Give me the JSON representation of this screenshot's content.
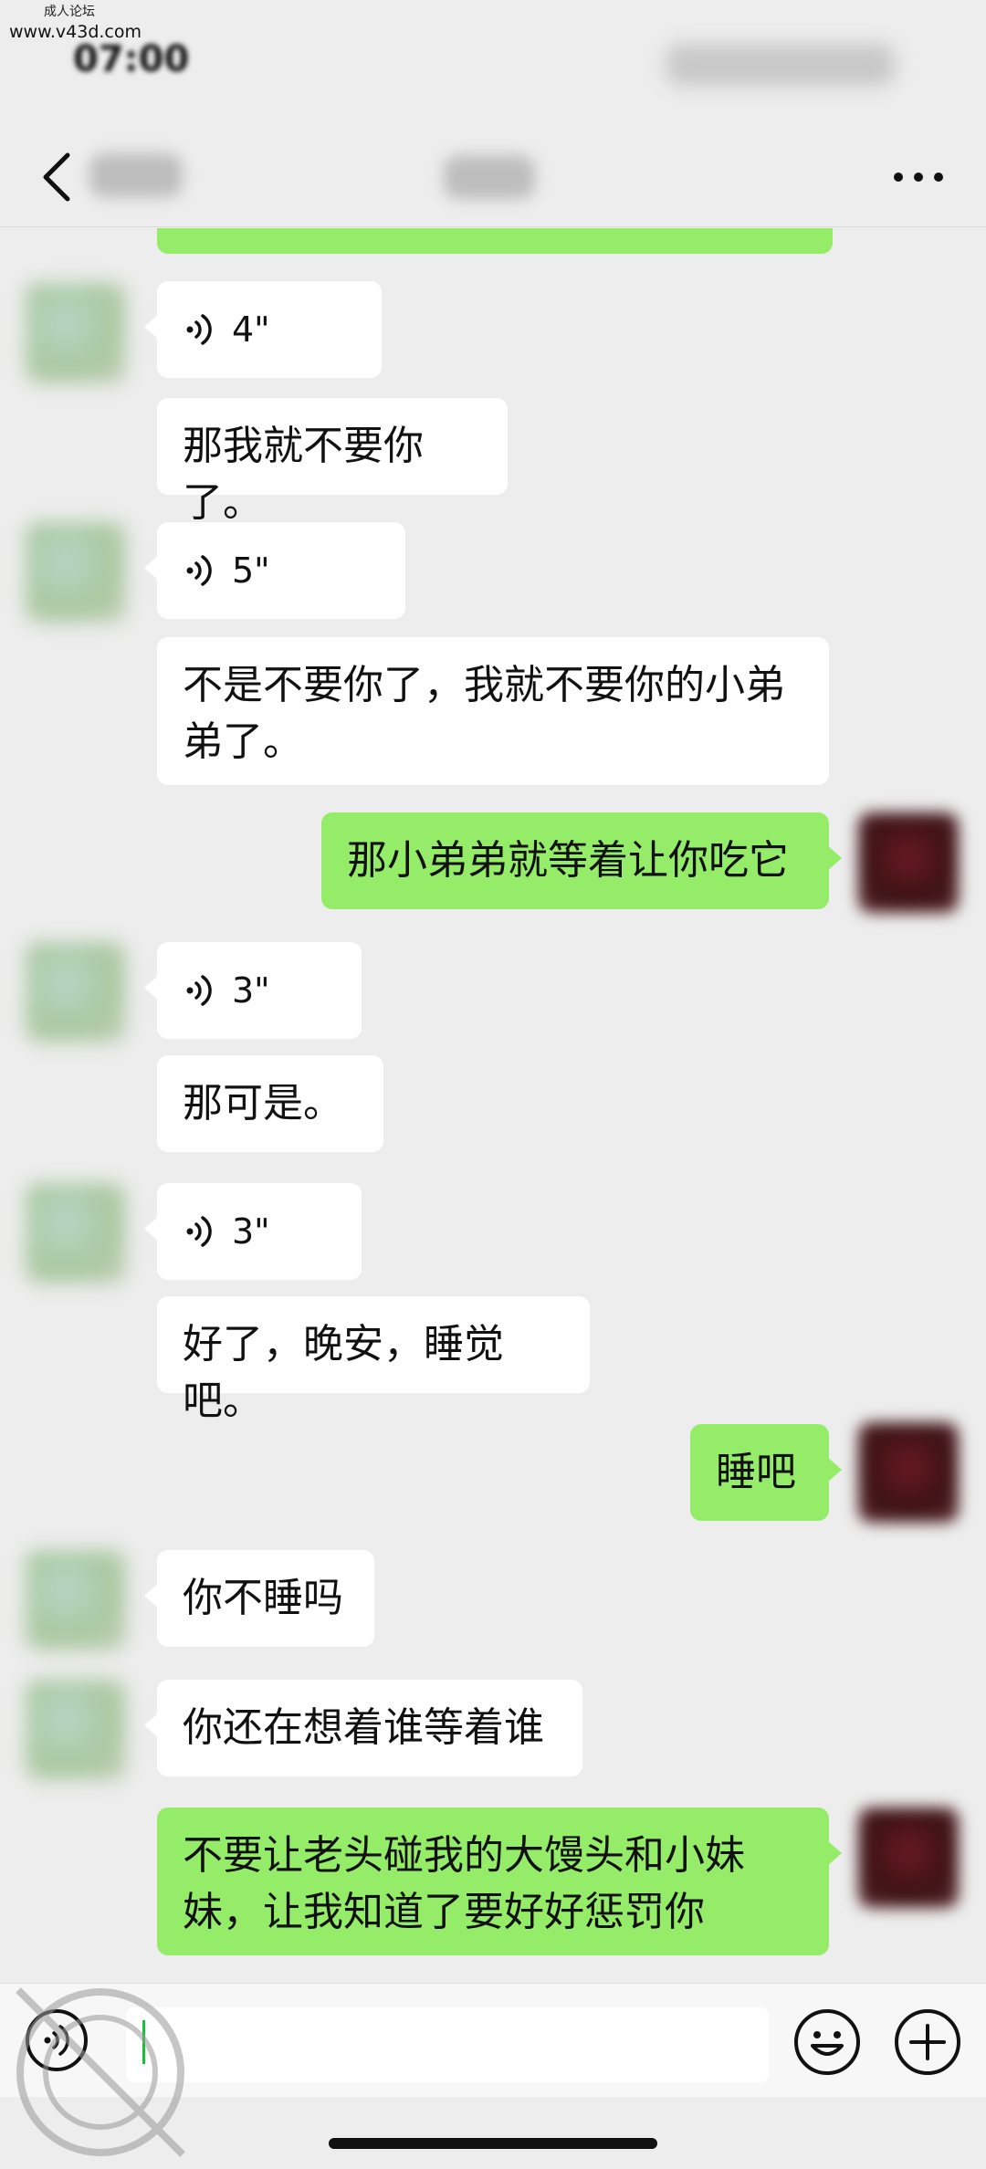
{
  "status_bar": {
    "watermark_label": "成人论坛",
    "watermark_url": "www.v43d.com",
    "time": "07:00"
  },
  "nav": {
    "back_icon": "chevron-left-icon",
    "more_icon": "ellipsis-icon"
  },
  "messages": [
    {
      "side": "other",
      "type": "voice",
      "duration": "4\""
    },
    {
      "side": "other",
      "type": "text",
      "text": "那我就不要你了。"
    },
    {
      "side": "other",
      "type": "voice",
      "duration": "5\""
    },
    {
      "side": "other",
      "type": "text",
      "text": "不是不要你了，我就不要你的小弟弟了。"
    },
    {
      "side": "self",
      "type": "text",
      "text": "那小弟弟就等着让你吃它"
    },
    {
      "side": "other",
      "type": "voice",
      "duration": "3\""
    },
    {
      "side": "other",
      "type": "text",
      "text": "那可是。"
    },
    {
      "side": "other",
      "type": "voice",
      "duration": "3\""
    },
    {
      "side": "other",
      "type": "text",
      "text": "好了，晚安，睡觉吧。"
    },
    {
      "side": "self",
      "type": "text",
      "text": "睡吧"
    },
    {
      "side": "other",
      "type": "text",
      "text": "你不睡吗"
    },
    {
      "side": "other",
      "type": "text",
      "text": "你还在想着谁等着谁"
    },
    {
      "side": "self",
      "type": "text",
      "text": "不要让老头碰我的大馒头和小妹妹，让我知道了要好好惩罚你"
    }
  ],
  "input_bar": {
    "voice_toggle_icon": "voice-mode-icon",
    "emoji_icon": "emoji-icon",
    "plus_icon": "plus-icon",
    "input_value": ""
  },
  "colors": {
    "background": "#ededed",
    "self_bubble": "#95ec69",
    "other_bubble": "#ffffff",
    "caret": "#19c03a"
  }
}
